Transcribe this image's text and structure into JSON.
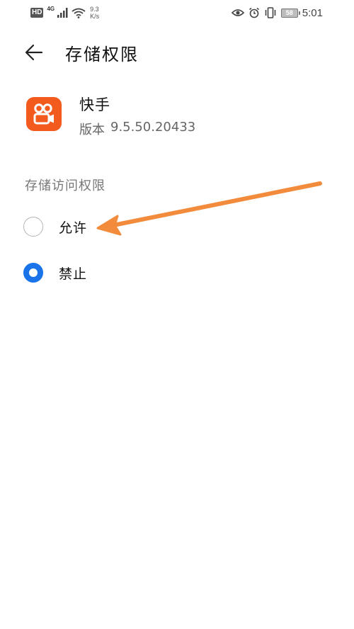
{
  "status_bar": {
    "hd_label": "HD",
    "network_type": "4G",
    "speed_value": "9.3",
    "speed_unit": "K/s",
    "battery_level": "58",
    "time": "5:01"
  },
  "header": {
    "title": "存储权限"
  },
  "app": {
    "name": "快手",
    "version_label": "版本",
    "version": "9.5.50.20433"
  },
  "permission": {
    "section_title": "存储访问权限",
    "options": [
      {
        "label": "允许",
        "selected": false
      },
      {
        "label": "禁止",
        "selected": true
      }
    ]
  },
  "colors": {
    "accent": "#1a73e8",
    "app_icon_bg": "#f25a1e",
    "annotation_arrow": "#f28c3c"
  },
  "icons": [
    "back-arrow-icon",
    "eye-icon",
    "alarm-icon",
    "vibrate-icon",
    "battery-icon",
    "wifi-icon",
    "signal-icon",
    "kuaishou-logo-icon"
  ]
}
